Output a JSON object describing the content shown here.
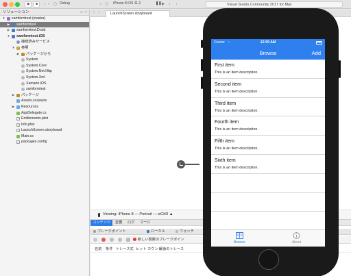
{
  "titlebar": {
    "configuration": "Debug",
    "device": "iPhone 8 iOS 11.2",
    "status": "Visual Studio Community 2017 for Mac"
  },
  "solution": {
    "title": "ソリューション",
    "rows": [
      {
        "label": "xamformtest (master)",
        "indent": 0,
        "icon": "sln",
        "arrow": "▼",
        "selected": false
      },
      {
        "label": "xamformtest",
        "indent": 1,
        "icon": "proj",
        "arrow": "▶",
        "selected": true
      },
      {
        "label": "xamformtest.Droid",
        "indent": 1,
        "icon": "proj",
        "arrow": "▶",
        "selected": false
      },
      {
        "label": "xamformtest.iOS",
        "indent": 1,
        "icon": "proj",
        "arrow": "▼",
        "selected": false,
        "bold": true
      },
      {
        "label": "接続済みサービス",
        "indent": 2,
        "icon": "svc",
        "arrow": "",
        "selected": false
      },
      {
        "label": "参照",
        "indent": 2,
        "icon": "ref",
        "arrow": "▼",
        "selected": false
      },
      {
        "label": "パッケージから",
        "indent": 3,
        "icon": "pkg",
        "arrow": "▶",
        "selected": false
      },
      {
        "label": "System",
        "indent": 3,
        "icon": "asm",
        "arrow": "",
        "selected": false
      },
      {
        "label": "System.Core",
        "indent": 3,
        "icon": "asm",
        "arrow": "",
        "selected": false
      },
      {
        "label": "System.Net.Http",
        "indent": 3,
        "icon": "asm",
        "arrow": "",
        "selected": false
      },
      {
        "label": "System.Xml",
        "indent": 3,
        "icon": "asm",
        "arrow": "",
        "selected": false
      },
      {
        "label": "Xamarin.iOS",
        "indent": 3,
        "icon": "asm",
        "arrow": "",
        "selected": false
      },
      {
        "label": "xamformtest",
        "indent": 3,
        "icon": "asm",
        "arrow": "",
        "selected": false
      },
      {
        "label": "パッケージ",
        "indent": 2,
        "icon": "pkg",
        "arrow": "▶",
        "selected": false
      },
      {
        "label": "Assets.xcassets",
        "indent": 2,
        "icon": "folder",
        "arrow": "",
        "selected": false
      },
      {
        "label": "Resources",
        "indent": 2,
        "icon": "folder",
        "arrow": "▶",
        "selected": false
      },
      {
        "label": "AppDelegate.cs",
        "indent": 2,
        "icon": "cs",
        "arrow": "",
        "selected": false
      },
      {
        "label": "Entitlements.plist",
        "indent": 2,
        "icon": "file",
        "arrow": "",
        "selected": false
      },
      {
        "label": "Info.plist",
        "indent": 2,
        "icon": "file",
        "arrow": "",
        "selected": false
      },
      {
        "label": "LaunchScreen.storyboard",
        "indent": 2,
        "icon": "file",
        "arrow": "",
        "selected": false
      },
      {
        "label": "Main.cs",
        "indent": 2,
        "icon": "cs",
        "arrow": "",
        "selected": false
      },
      {
        "label": "packages.config",
        "indent": 2,
        "icon": "file",
        "arrow": "",
        "selected": false
      }
    ]
  },
  "editor": {
    "tab": "LaunchScreen.storyboard",
    "viewing": "Viewing: iPhone 8 — Portrait — wChR",
    "viewing_chevron": "▲",
    "prop_tabs": [
      "コンテンツ",
      "変更",
      "ログ",
      "マージ"
    ],
    "pad_tabs": [
      "ブレークポイント",
      "ローカル",
      "ウォッチ"
    ],
    "new_breakpoint": "新しい関数のブレークポイン",
    "columns": [
      "名前",
      "条件",
      "トレース式",
      "ヒット カウント",
      "最後のトレース"
    ]
  },
  "simulator": {
    "carrier": "Carrier",
    "time": "12:59 AM",
    "title": "Browse",
    "add": "Add",
    "items": [
      {
        "title": "First item",
        "desc": "This is an item description."
      },
      {
        "title": "Second item",
        "desc": "This is an item description."
      },
      {
        "title": "Third item",
        "desc": "This is an item description."
      },
      {
        "title": "Fourth item",
        "desc": "This is an item description."
      },
      {
        "title": "Fifth item",
        "desc": "This is an item description."
      },
      {
        "title": "Sixth item",
        "desc": "This is an item description."
      }
    ],
    "tabs": [
      {
        "label": "Browse",
        "color": "#2f80ef"
      },
      {
        "label": "About",
        "color": "#8e8e8e"
      }
    ]
  }
}
